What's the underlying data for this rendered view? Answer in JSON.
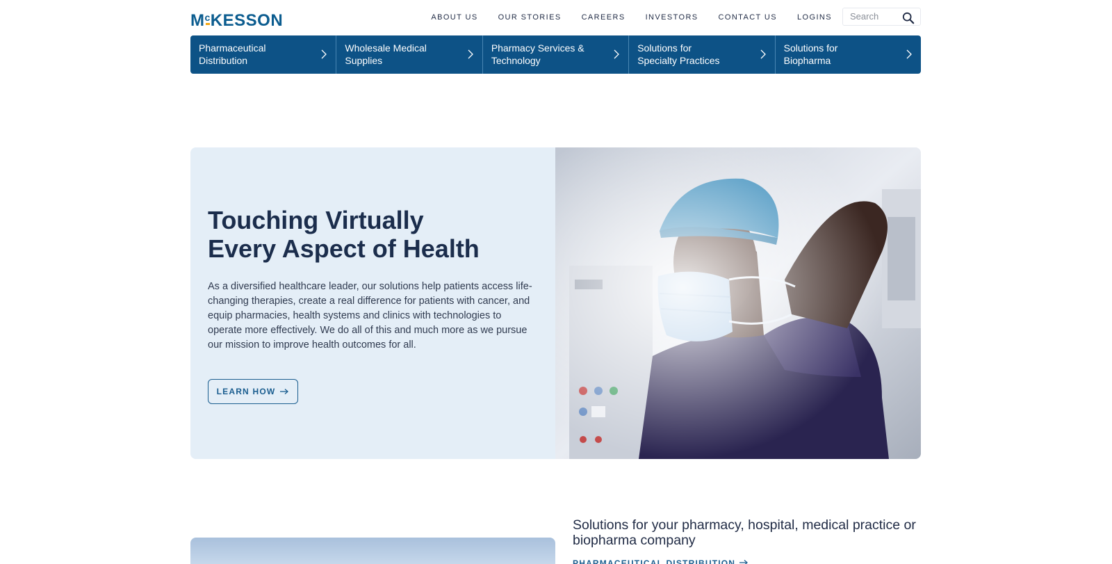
{
  "brand": {
    "logo_text_pre": "M",
    "logo_text_sup": "c",
    "logo_text_post": "KESSON",
    "primary_color": "#0d5286",
    "accent_color": "#f3a712"
  },
  "topnav": [
    {
      "label": "ABOUT US"
    },
    {
      "label": "OUR STORIES"
    },
    {
      "label": "CAREERS"
    },
    {
      "label": "INVESTORS"
    },
    {
      "label": "CONTACT US"
    },
    {
      "label": "LOGINS"
    }
  ],
  "search": {
    "placeholder": "Search",
    "icon": "search-icon"
  },
  "categories": [
    {
      "label_line1": "Pharmaceutical",
      "label_line2": "Distribution"
    },
    {
      "label_line1": "Wholesale Medical",
      "label_line2": "Supplies"
    },
    {
      "label_line1": "Pharmacy Services &",
      "label_line2": "Technology"
    },
    {
      "label_line1": "Solutions for",
      "label_line2": "Specialty Practices"
    },
    {
      "label_line1": "Solutions for",
      "label_line2": "Biopharma"
    }
  ],
  "hero": {
    "title_line1": "Touching Virtually",
    "title_line2": "Every Aspect of Health",
    "body": "As a diversified healthcare leader, our solutions help patients access life-changing therapies, create a real difference for patients with cancer, and equip pharmacies, health systems and clinics with technologies to operate more effectively. We do all of this and much more as we pursue our mission to improve health outcomes for all.",
    "button_label": "LEARN HOW",
    "button_icon": "arrow-right-icon",
    "background_color": "#e4eef7"
  },
  "solutions": {
    "heading": "Solutions for your pharmacy, hospital, medical practice or biopharma company",
    "first_link": "PHARMACEUTICAL DISTRIBUTION"
  }
}
